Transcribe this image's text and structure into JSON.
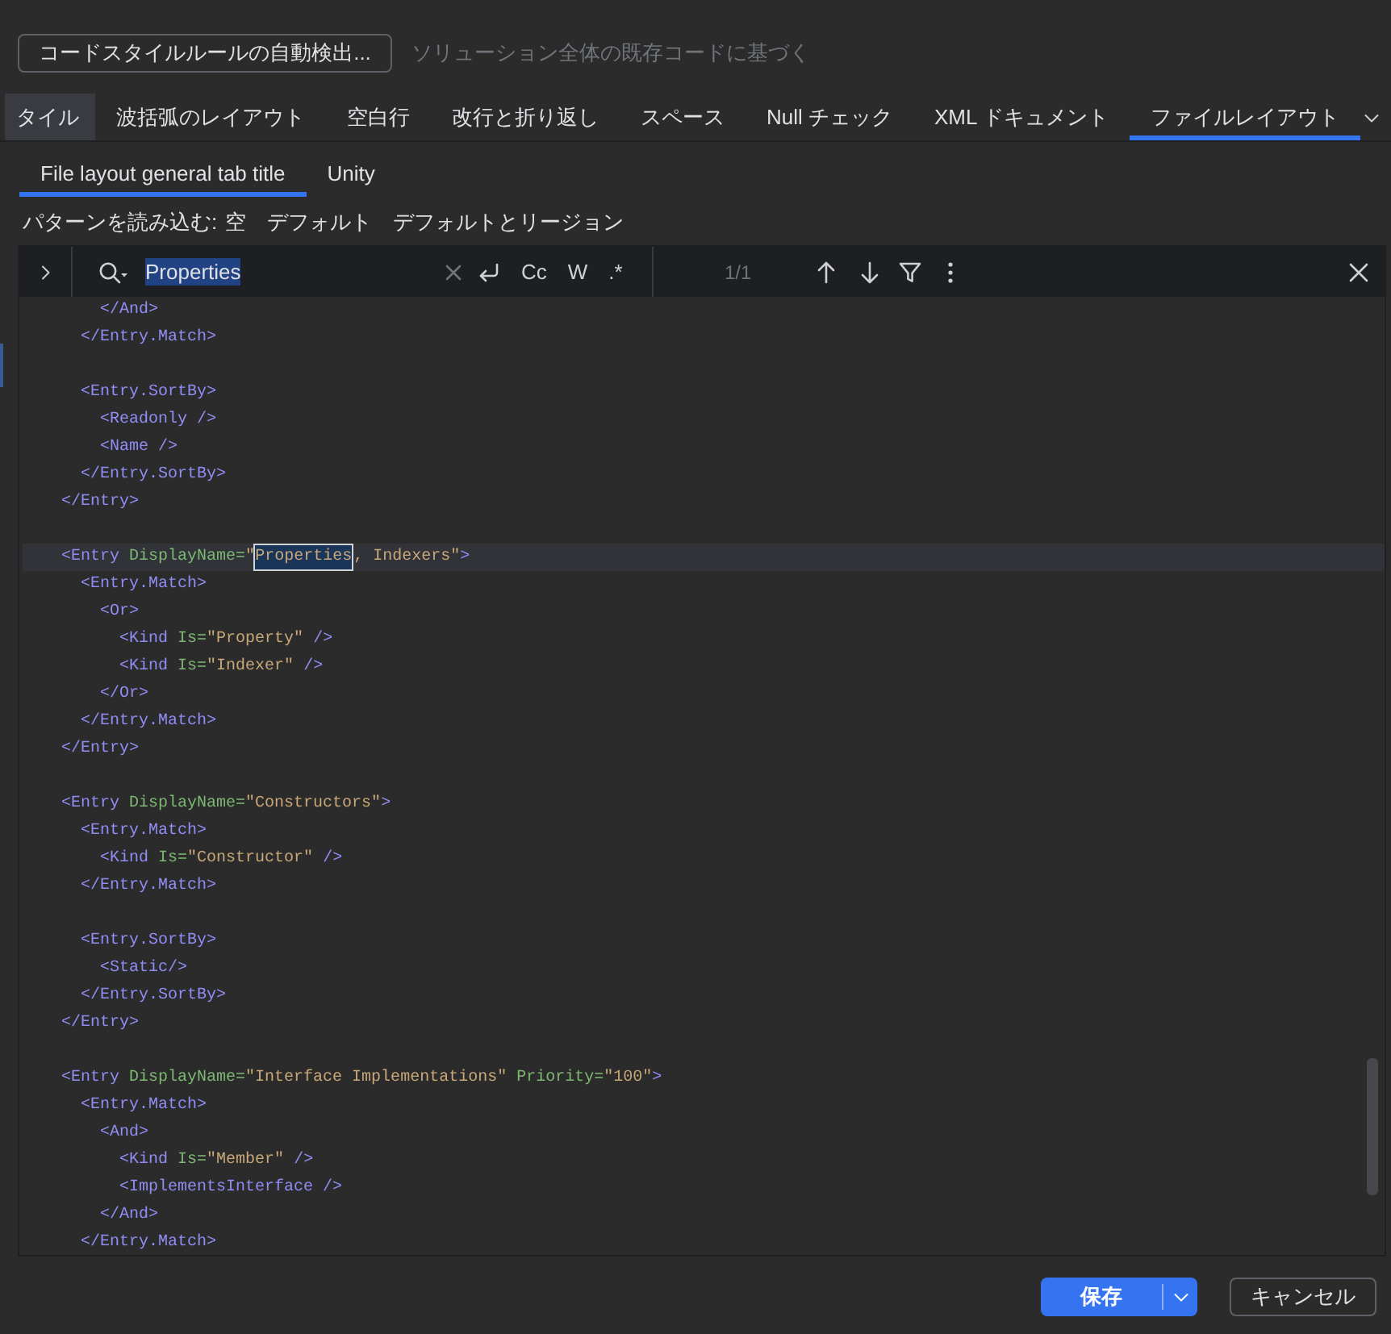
{
  "toolbar": {
    "detect_button": "コードスタイルルールの自動検出...",
    "hint": "ソリューション全体の既存コードに基づく"
  },
  "tabs": [
    {
      "label": "タイル",
      "selected": false,
      "hovered": true
    },
    {
      "label": "波括弧のレイアウト",
      "selected": false,
      "hovered": false
    },
    {
      "label": "空白行",
      "selected": false,
      "hovered": false
    },
    {
      "label": "改行と折り返し",
      "selected": false,
      "hovered": false
    },
    {
      "label": "スペース",
      "selected": false,
      "hovered": false
    },
    {
      "label": "Null チェック",
      "selected": false,
      "hovered": false
    },
    {
      "label": "XML ドキュメント",
      "selected": false,
      "hovered": false
    },
    {
      "label": "ファイルレイアウト",
      "selected": true,
      "hovered": false
    }
  ],
  "sub_tabs": [
    {
      "label": "File layout general tab title",
      "selected": true
    },
    {
      "label": "Unity",
      "selected": false
    }
  ],
  "patterns": {
    "label": "パターンを読み込む:",
    "options": [
      "空",
      "デフォルト",
      "デフォルトとリージョン"
    ]
  },
  "search": {
    "value": "Properties",
    "options": [
      "Cc",
      "W",
      ".*"
    ],
    "count": "1/1"
  },
  "code": {
    "lines": [
      {
        "kind": "code",
        "current": false,
        "text": "        </And>"
      },
      {
        "kind": "code",
        "current": false,
        "text": "      </Entry.Match>"
      },
      {
        "kind": "blank",
        "current": false
      },
      {
        "kind": "code",
        "current": false,
        "text": "      <Entry.SortBy>"
      },
      {
        "kind": "code",
        "current": false,
        "text": "        <Readonly />"
      },
      {
        "kind": "code",
        "current": false,
        "text": "        <Name />"
      },
      {
        "kind": "code",
        "current": false,
        "text": "      </Entry.SortBy>"
      },
      {
        "kind": "code",
        "current": false,
        "text": "    </Entry>"
      },
      {
        "kind": "blank",
        "current": false
      },
      {
        "kind": "code",
        "current": true,
        "parts": [
          {
            "text": "    <Entry DisplayName=\"",
            "match": false
          },
          {
            "text": "Properties",
            "match": true
          },
          {
            "text": ", Indexers\">",
            "match": false
          }
        ]
      },
      {
        "kind": "code",
        "current": false,
        "text": "      <Entry.Match>"
      },
      {
        "kind": "code",
        "current": false,
        "text": "        <Or>"
      },
      {
        "kind": "code",
        "current": false,
        "text": "          <Kind Is=\"Property\" />"
      },
      {
        "kind": "code",
        "current": false,
        "text": "          <Kind Is=\"Indexer\" />"
      },
      {
        "kind": "code",
        "current": false,
        "text": "        </Or>"
      },
      {
        "kind": "code",
        "current": false,
        "text": "      </Entry.Match>"
      },
      {
        "kind": "code",
        "current": false,
        "text": "    </Entry>"
      },
      {
        "kind": "blank",
        "current": false
      },
      {
        "kind": "code",
        "current": false,
        "text": "    <Entry DisplayName=\"Constructors\">"
      },
      {
        "kind": "code",
        "current": false,
        "text": "      <Entry.Match>"
      },
      {
        "kind": "code",
        "current": false,
        "text": "        <Kind Is=\"Constructor\" />"
      },
      {
        "kind": "code",
        "current": false,
        "text": "      </Entry.Match>"
      },
      {
        "kind": "blank",
        "current": false
      },
      {
        "kind": "code",
        "current": false,
        "text": "      <Entry.SortBy>"
      },
      {
        "kind": "code",
        "current": false,
        "text": "        <Static/>"
      },
      {
        "kind": "code",
        "current": false,
        "text": "      </Entry.SortBy>"
      },
      {
        "kind": "code",
        "current": false,
        "text": "    </Entry>"
      },
      {
        "kind": "blank",
        "current": false
      },
      {
        "kind": "code",
        "current": false,
        "text": "    <Entry DisplayName=\"Interface Implementations\" Priority=\"100\">"
      },
      {
        "kind": "code",
        "current": false,
        "text": "      <Entry.Match>"
      },
      {
        "kind": "code",
        "current": false,
        "text": "        <And>"
      },
      {
        "kind": "code",
        "current": false,
        "text": "          <Kind Is=\"Member\" />"
      },
      {
        "kind": "code",
        "current": false,
        "text": "          <ImplementsInterface />"
      },
      {
        "kind": "code",
        "current": false,
        "text": "        </And>"
      },
      {
        "kind": "code",
        "current": false,
        "text": "      </Entry.Match>"
      }
    ]
  },
  "buttons": [
    {
      "kind": "split",
      "label": "保存"
    },
    {
      "kind": "plain",
      "label": "キャンセル"
    }
  ]
}
